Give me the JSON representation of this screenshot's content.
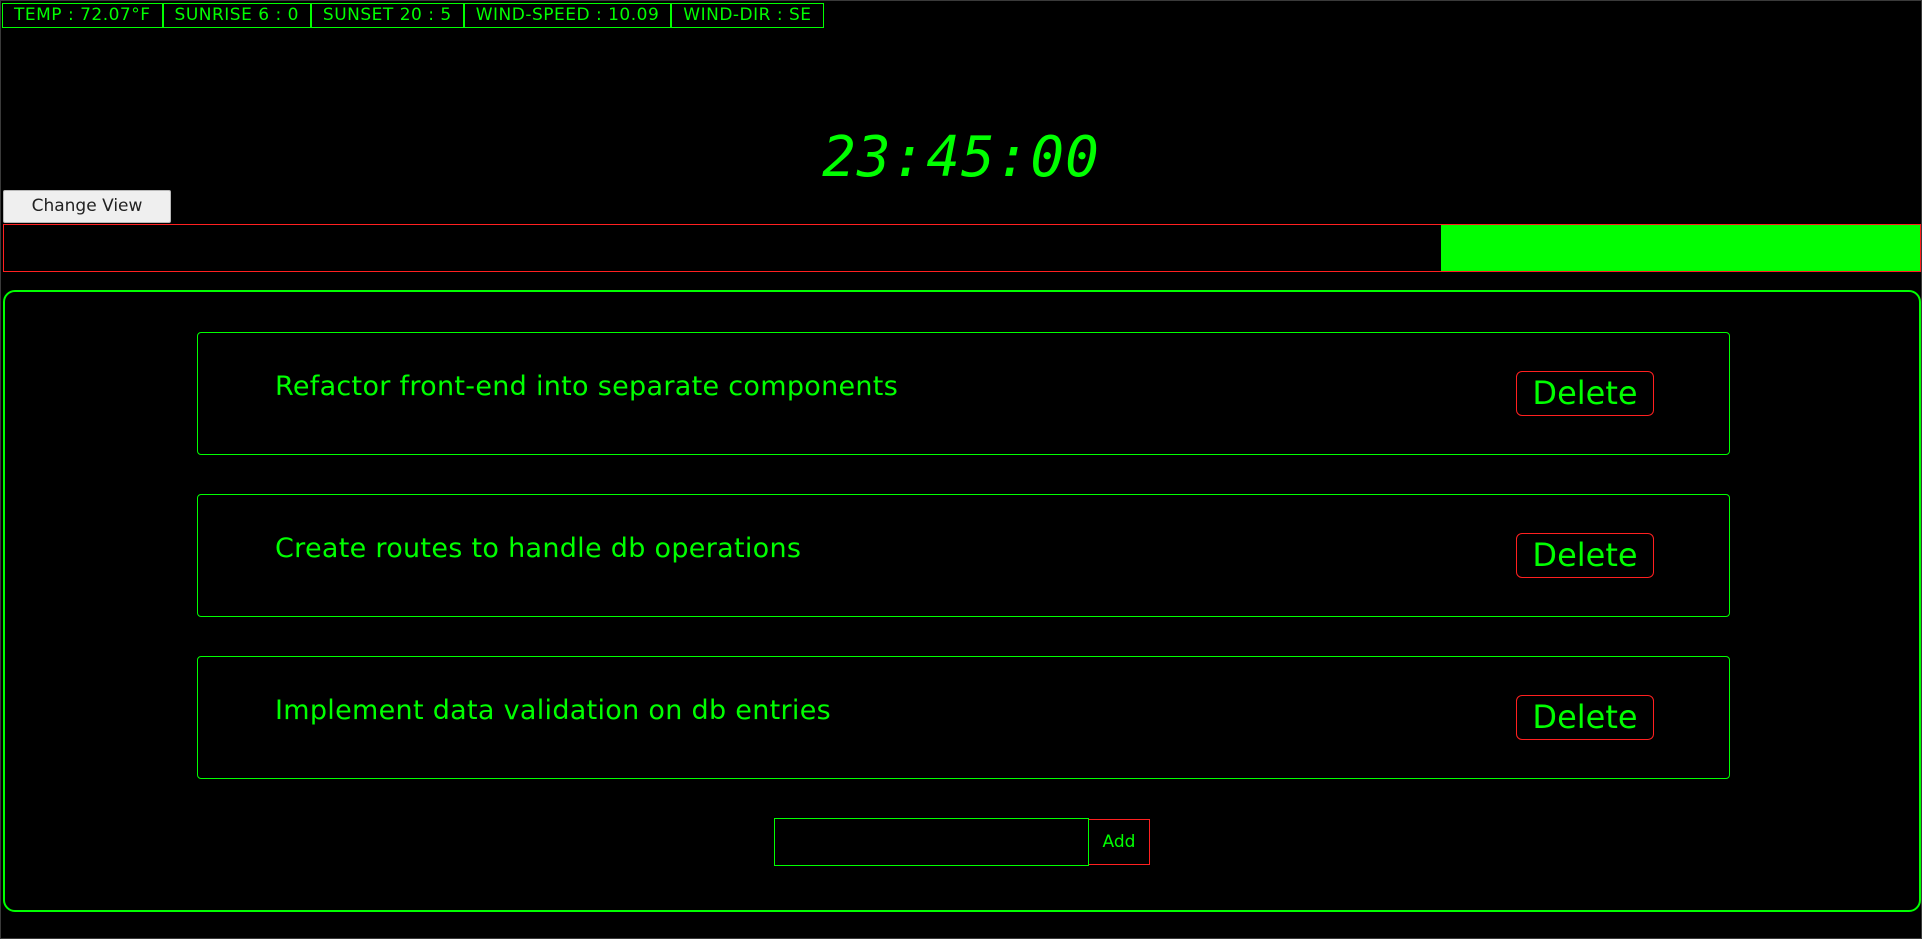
{
  "weather": {
    "temp": "TEMP : 72.07°F",
    "sunrise": "SUNRISE 6 : 0",
    "sunset": "SUNSET 20 : 5",
    "wind_speed": "WIND-SPEED : 10.09",
    "wind_dir": "WIND-DIR : SE"
  },
  "clock": "23:45:00",
  "change_view_label": "Change View",
  "progress": {
    "filled_fraction": 0.25,
    "fill_color": "#00ff00",
    "border_color": "#ff2020"
  },
  "tasks": [
    {
      "text": "Refactor front-end into separate components",
      "delete_label": "Delete"
    },
    {
      "text": "Create routes to handle db operations",
      "delete_label": "Delete"
    },
    {
      "text": "Implement data validation on db entries",
      "delete_label": "Delete"
    }
  ],
  "add": {
    "input_value": "",
    "input_placeholder": "",
    "button_label": "Add"
  },
  "colors": {
    "accent": "#00ff00",
    "danger": "#ff2020",
    "background": "#000000"
  }
}
